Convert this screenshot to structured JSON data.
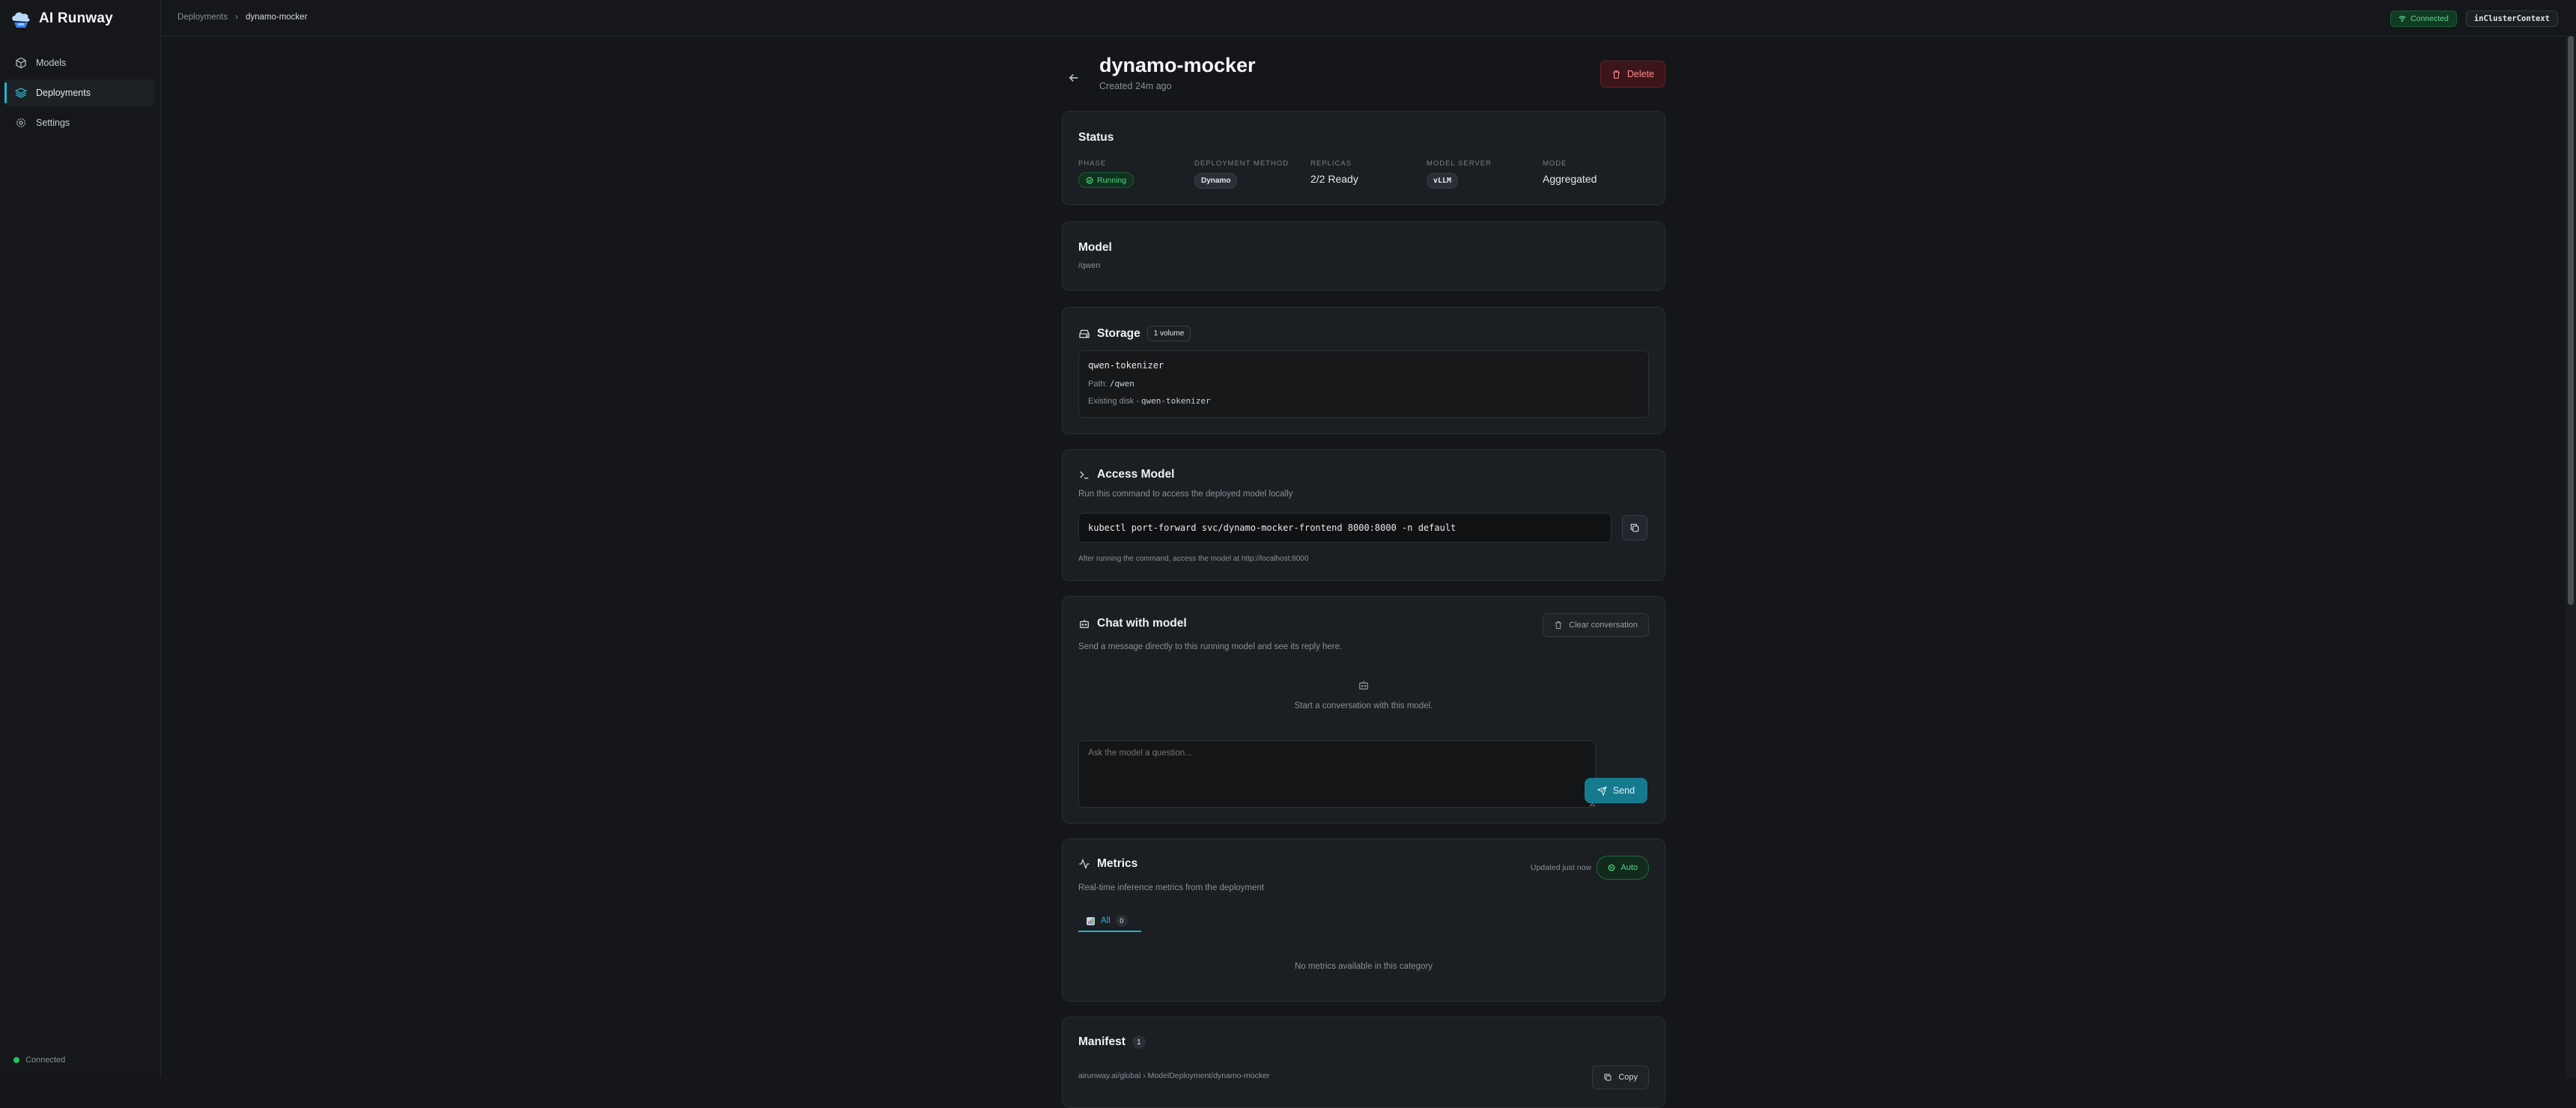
{
  "app": {
    "name": "AI Runway"
  },
  "sidebar": {
    "items": [
      {
        "label": "Models",
        "icon": "cube-icon"
      },
      {
        "label": "Deployments",
        "icon": "layers-icon"
      },
      {
        "label": "Settings",
        "icon": "gear-icon"
      }
    ],
    "status": "Connected"
  },
  "header": {
    "breadcrumb": [
      "Deployments",
      "dynamo-mocker"
    ],
    "connection": "Connected",
    "context": "inClusterContext"
  },
  "deployment": {
    "name": "dynamo-mocker",
    "created": "Created 24m ago",
    "delete_label": "Delete"
  },
  "status_card": {
    "title": "Status",
    "phase_label": "PHASE",
    "phase": "Running",
    "method_label": "DEPLOYMENT METHOD",
    "method": "Dynamo",
    "replicas_label": "REPLICAS",
    "replicas": "2/2 Ready",
    "server_label": "MODEL SERVER",
    "server": "vLLM",
    "mode_label": "MODE",
    "mode": "Aggregated"
  },
  "model_card": {
    "title": "Model",
    "value": "/qwen"
  },
  "storage_card": {
    "title": "Storage",
    "badge": "1 volume",
    "volume_name": "qwen-tokenizer",
    "path_label": "Path:",
    "path": "/qwen",
    "source_label": "Existing disk -",
    "source": "qwen-tokenizer"
  },
  "access_card": {
    "title": "Access Model",
    "desc": "Run this command to access the deployed model locally",
    "command": "kubectl port-forward svc/dynamo-mocker-frontend 8000:8000 -n default",
    "note": "After running the command, access the model at http://localhost:8000"
  },
  "chat_card": {
    "title": "Chat with model",
    "desc": "Send a message directly to this running model and see its reply here.",
    "clear_label": "Clear conversation",
    "empty": "Start a conversation with this model.",
    "placeholder": "Ask the model a question...",
    "send_label": "Send"
  },
  "metrics_card": {
    "title": "Metrics",
    "desc": "Real-time inference metrics from the deployment",
    "updated": "Updated just now",
    "auto_label": "Auto",
    "tab_label": "All",
    "tab_count": "0",
    "empty": "No metrics available in this category"
  },
  "manifest_card": {
    "title": "Manifest",
    "count": "1",
    "resource": "airunway.ai/global › ModelDeployment/dynamo-mocker",
    "copy_label": "Copy"
  },
  "colors": {
    "accent": "#23b4cf",
    "success": "#22c55e",
    "danger": "#ff8a8f"
  }
}
